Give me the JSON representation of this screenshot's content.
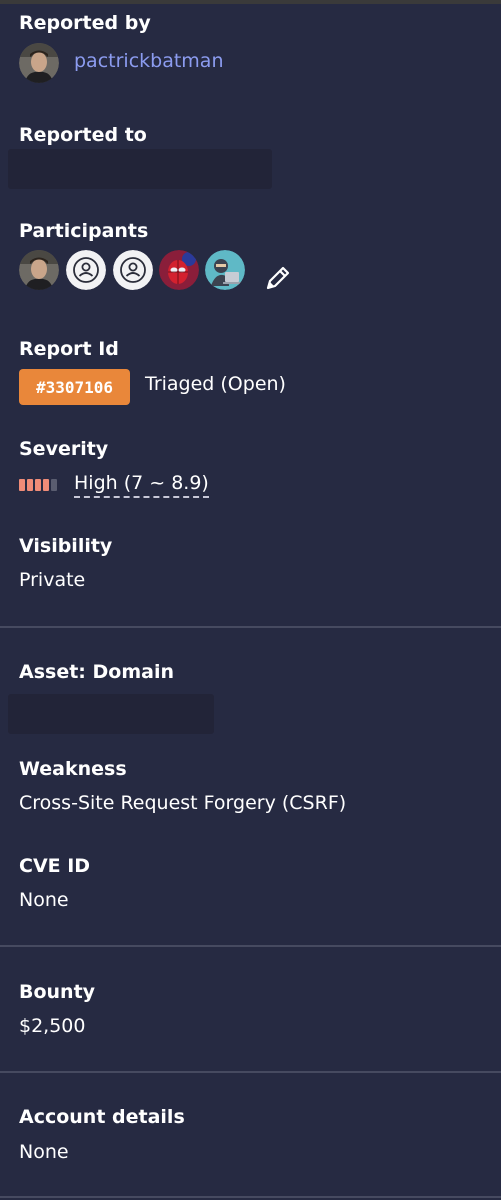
{
  "reported_by": {
    "label": "Reported by",
    "username": "pactrickbatman"
  },
  "reported_to": {
    "label": "Reported to"
  },
  "participants": {
    "label": "Participants",
    "avatars": [
      "person-photo-avatar",
      "default-user-icon",
      "default-user-icon",
      "spider-man-avatar",
      "hacker-avatar"
    ],
    "edit_icon": "pencil-icon"
  },
  "report": {
    "label": "Report Id",
    "id": "#3307106",
    "state": "Triaged (Open)"
  },
  "severity": {
    "label": "Severity",
    "rating": "High (7 ~ 8.9)",
    "filled_segments": 4,
    "total_segments": 5,
    "fill_color": "#f08c78",
    "empty_color": "#5a5d70"
  },
  "visibility": {
    "label": "Visibility",
    "value": "Private"
  },
  "asset": {
    "label": "Asset: Domain"
  },
  "weakness": {
    "label": "Weakness",
    "value": "Cross-Site Request Forgery (CSRF)"
  },
  "cve": {
    "label": "CVE ID",
    "value": "None"
  },
  "bounty": {
    "label": "Bounty",
    "value": "$2,500"
  },
  "account_details": {
    "label": "Account details",
    "value": "None"
  },
  "colors": {
    "background": "#262a42",
    "link": "#8c9cf0",
    "badge": "#e9873a",
    "divider": "#464a60"
  }
}
